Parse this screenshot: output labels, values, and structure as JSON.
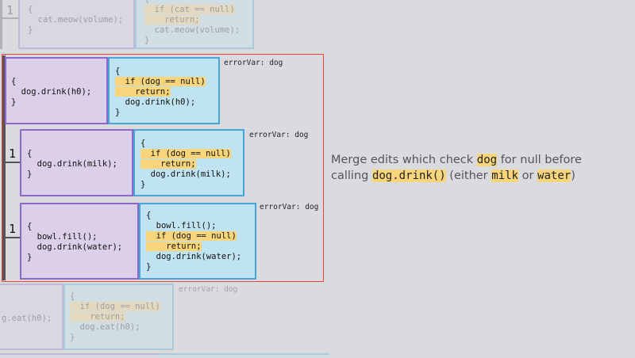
{
  "top_cluster": {
    "count": "1",
    "before_code": "{\n  cat.meow(volume);\n}",
    "after_line1": "{",
    "after_highlight": "  if (cat == null)\n    return;",
    "after_rest": "  cat.meow(volume);\n}"
  },
  "group": {
    "items": [
      {
        "error_var": "errorVar: dog",
        "before_code": "{\n  dog.drink(h0);\n}",
        "after_pre": "{",
        "after_highlight": "  if (dog == null)\n    return;",
        "after_post": "  dog.drink(h0);\n}"
      },
      {
        "count": "1",
        "error_var": "errorVar: dog",
        "before_code": "{\n  dog.drink(milk);\n}",
        "after_pre": "{",
        "after_highlight": "  if (dog == null)\n    return;",
        "after_post": "  dog.drink(milk);\n}"
      },
      {
        "count": "1",
        "error_var": "errorVar: dog",
        "before_code": "{\n  bowl.fill();\n  dog.drink(water);\n}",
        "after_pre": "{\n  bowl.fill();",
        "after_highlight": "  if (dog == null)\n    return;",
        "after_post": "  dog.drink(water);\n}"
      }
    ]
  },
  "bottom_cluster": {
    "error_var": "errorVar: dog",
    "before_code": "g.eat(h0);",
    "after_pre": "{",
    "after_highlight": "  if (dog == null)\n    return;",
    "after_post": "  dog.eat(h0);\n}"
  },
  "description": {
    "part1": "Merge edits which check ",
    "code1": "dog",
    "part2": " for null before calling ",
    "code2": "dog.drink()",
    "part3": " (either ",
    "code3": "milk",
    "part4": " or ",
    "code4": "water",
    "part5": ")"
  },
  "colors": {
    "background": "#d9dbdf",
    "before_fill": "#dccfea",
    "before_border": "#8e68c8",
    "after_fill": "#bfe3f0",
    "after_border": "#47a6d8",
    "highlight": "#f8d57a",
    "selection_frame": "#e8453c"
  }
}
